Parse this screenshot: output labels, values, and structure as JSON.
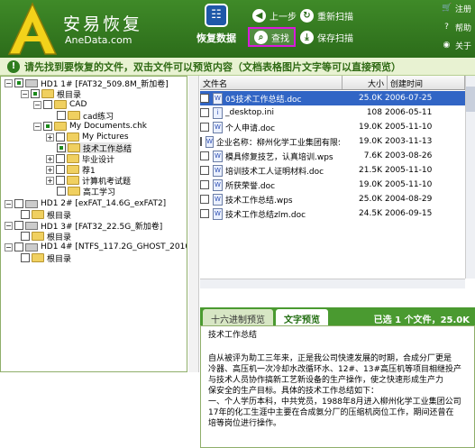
{
  "header": {
    "app_name": "安易恢复",
    "app_url": "AneData.com",
    "recover_label": "恢复数据",
    "prev_label": "上一步",
    "rescan_label": "重新扫描",
    "search_label": "查找",
    "save_scan_label": "保存扫描",
    "register_label": "注册",
    "help_label": "帮助",
    "about_label": "关于"
  },
  "tip": "请先找到要恢复的文件，双击文件可以预览内容（文档表格图片文字等可以直接预览）",
  "tree": [
    {
      "label": "HD1  1# [FAT32_509.8M_新加卷]"
    },
    {
      "label": "根目录"
    },
    {
      "label": "CAD"
    },
    {
      "label": "cad练习"
    },
    {
      "label": "My Documents.chk"
    },
    {
      "label": "My Pictures"
    },
    {
      "label": "技术工作总结"
    },
    {
      "label": "毕业设计"
    },
    {
      "label": "荐1"
    },
    {
      "label": "计算机考试题"
    },
    {
      "label": "高工学习"
    },
    {
      "label": "HD1  2# [exFAT_14.6G_exFAT2]"
    },
    {
      "label": "根目录"
    },
    {
      "label": "HD1  3# [FAT32_22.5G_新加卷]"
    },
    {
      "label": "根目录"
    },
    {
      "label": "HD1  4# [NTFS_117.2G_GHOST_2010-09-03]"
    },
    {
      "label": "根目录"
    }
  ],
  "list": {
    "headers": [
      "文件名",
      "大小",
      "创建时间"
    ],
    "rows": [
      {
        "name": "05技术工作总结.doc",
        "size": "25.0K",
        "date": "2006-07-25"
      },
      {
        "name": "_desktop.ini",
        "size": "108",
        "date": "2006-05-11"
      },
      {
        "name": "个人申请.doc",
        "size": "19.0K",
        "date": "2005-11-10"
      },
      {
        "name": "企业名称：柳州化学工业集团有限公司",
        "size": "19.0K",
        "date": "2003-11-13"
      },
      {
        "name": "模具修复技艺，认真培训.wps",
        "size": "7.6K",
        "date": "2003-08-26"
      },
      {
        "name": "培训技术工人证明材料.doc",
        "size": "21.5K",
        "date": "2005-11-10"
      },
      {
        "name": "所获荣誉.doc",
        "size": "19.0K",
        "date": "2005-11-10"
      },
      {
        "name": "技术工作总结.wps",
        "size": "25.0K",
        "date": "2004-08-29"
      },
      {
        "name": "技术工作总结zlm.doc",
        "size": "24.5K",
        "date": "2006-09-15"
      }
    ]
  },
  "tabs": {
    "hex": "十六进制预览",
    "text": "文字预览"
  },
  "selected_info": "已选 1 个文件，25.0K",
  "preview": {
    "title": "技术工作总结",
    "lines": [
      "自从被评为助工三年来，正是我公司快速发展的时期，合成分厂更是",
      "冷器、高压机一次冷却水改循环水、12#、13#高压机等项目相继投产",
      "与技术人员协作搞新工艺新设备的生产操作，使之快速形成生产力",
      "保安全的生产目标。具体的技术工作总结如下：",
      "一、个人学历本科，中共党员，1988年8月进入柳州化学工业集团公司",
      "17年的化工生涯中主要在合成氨分厂的压缩机岗位工作，期间还曾在",
      "培等岗位进行操作。"
    ]
  }
}
